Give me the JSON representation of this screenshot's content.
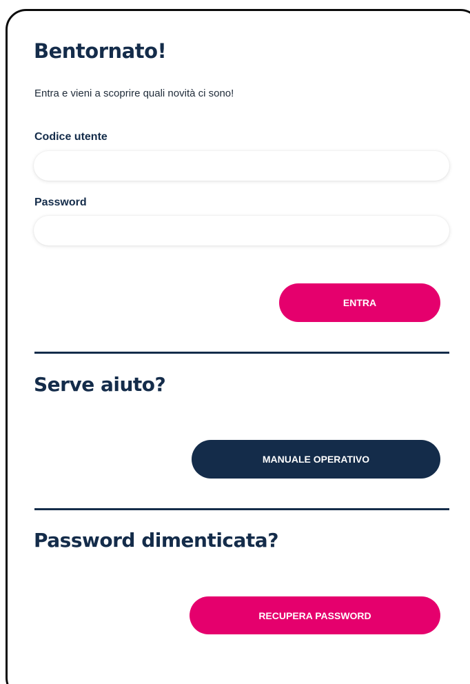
{
  "login": {
    "title": "Bentornato!",
    "subtitle": "Entra e vieni a scoprire quali novità ci sono!",
    "user_label": "Codice utente",
    "user_value": "",
    "password_label": "Password",
    "password_value": "",
    "submit_label": "ENTRA"
  },
  "help": {
    "title": "Serve aiuto?",
    "manual_label": "MANUALE OPERATIVO"
  },
  "forgot": {
    "title": "Password dimenticata?",
    "recover_label": "RECUPERA PASSWORD"
  },
  "colors": {
    "primary_pink": "#e5006d",
    "navy": "#142c4a",
    "card_border": "#0b0b0b"
  }
}
